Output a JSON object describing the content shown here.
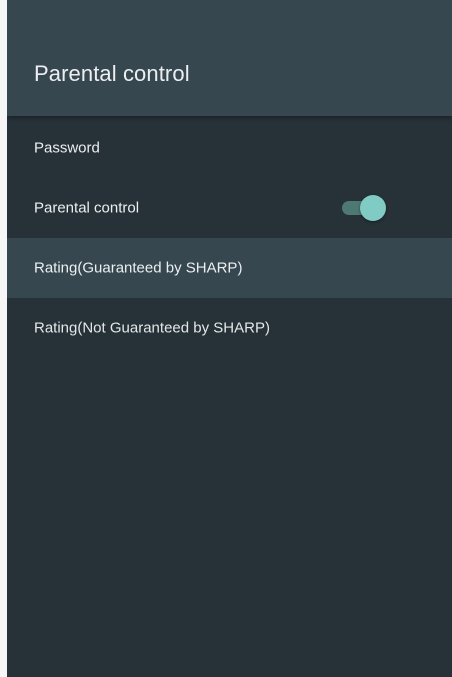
{
  "header": {
    "title": "Parental control"
  },
  "menu": {
    "items": [
      {
        "label": "Password"
      },
      {
        "label": "Parental control",
        "toggle_state": "on"
      },
      {
        "label": "Rating(Guaranteed by SHARP)",
        "focused": true
      },
      {
        "label": "Rating(Not Guaranteed by SHARP)"
      }
    ]
  },
  "colors": {
    "panel_bg": "#263238",
    "header_bg": "#37474f",
    "focused_row_bg": "#37474f",
    "toggle_thumb": "#80cbc4",
    "toggle_track": "#4e7972",
    "text": "#eceff1"
  }
}
